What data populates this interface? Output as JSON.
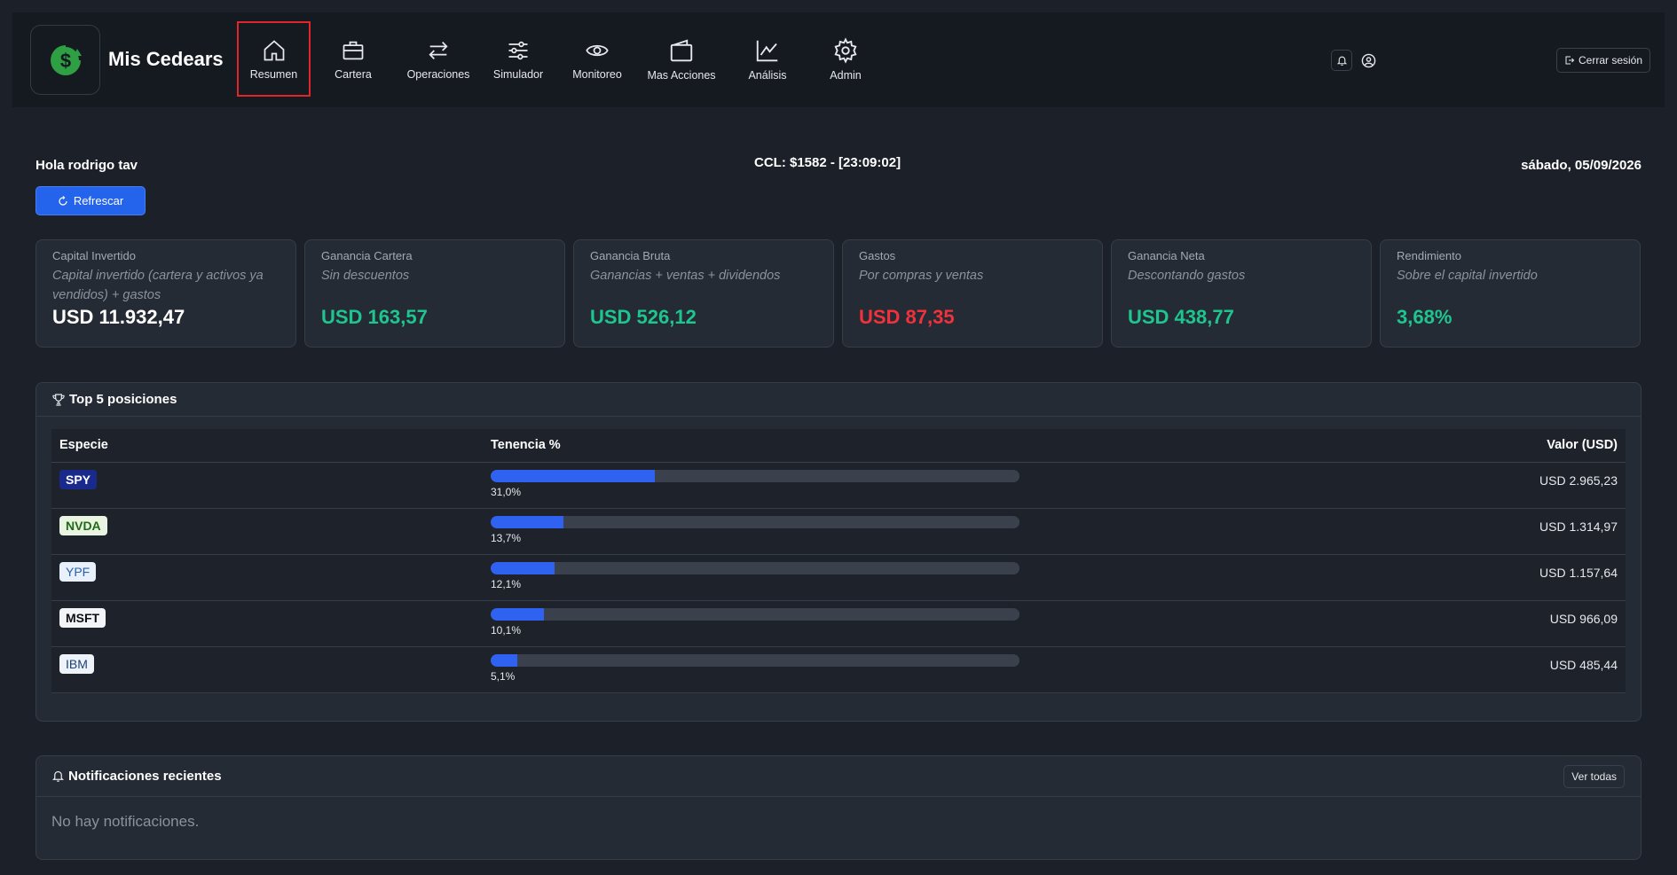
{
  "nav": {
    "brand": "Mis Cedears",
    "items": [
      {
        "label": "Resumen",
        "icon": "home-icon",
        "active": true
      },
      {
        "label": "Cartera",
        "icon": "briefcase-icon"
      },
      {
        "label": "Operaciones",
        "icon": "arrows-swap-icon"
      },
      {
        "label": "Simulador",
        "icon": "sliders-icon"
      },
      {
        "label": "Monitoreo",
        "icon": "eye-icon"
      },
      {
        "label": "Mas Acciones",
        "icon": "wallet-icon"
      },
      {
        "label": "Análisis",
        "icon": "chart-line-icon"
      },
      {
        "label": "Admin",
        "icon": "gear-icon"
      }
    ],
    "logout_label": "Cerrar sesión"
  },
  "header": {
    "greeting": "Hola rodrigo tav",
    "ccl": "CCL: $1582 - [23:09:02]",
    "date": "sábado, 05/09/2026",
    "refresh_label": "Refrescar"
  },
  "cards": [
    {
      "title": "Capital Invertido",
      "subtitle": "Capital invertido (cartera y activos ya vendidos) + gastos",
      "value": "USD 11.932,47",
      "color": "#ffffff"
    },
    {
      "title": "Ganancia Cartera",
      "subtitle": "Sin descuentos",
      "value": "USD 163,57",
      "color": "#1fc58e"
    },
    {
      "title": "Ganancia Bruta",
      "subtitle": "Ganancias + ventas + dividendos",
      "value": "USD 526,12",
      "color": "#1fc58e"
    },
    {
      "title": "Gastos",
      "subtitle": "Por compras y ventas",
      "value": "USD 87,35",
      "color": "#f0323c"
    },
    {
      "title": "Ganancia Neta",
      "subtitle": "Descontando gastos",
      "value": "USD 438,77",
      "color": "#1fc58e"
    },
    {
      "title": "Rendimiento",
      "subtitle": "Sobre el capital invertido",
      "value": "3,68%",
      "color": "#1fc58e"
    }
  ],
  "top5": {
    "title": "Top 5 posiciones",
    "headers": [
      "Especie",
      "Tenencia %",
      "Valor (USD)"
    ],
    "rows": [
      {
        "ticker": "SPY",
        "pct_label": "31,0%",
        "pct": 31.0,
        "value": "USD 2.965,23",
        "tag_bg": "#1a2a8c",
        "tag_fg": "#ffffff",
        "bold": true
      },
      {
        "ticker": "NVDA",
        "pct_label": "13,7%",
        "pct": 13.7,
        "value": "USD 1.314,97",
        "tag_bg": "#e9f5e2",
        "tag_fg": "#1f6b14",
        "bold": true
      },
      {
        "ticker": "YPF",
        "pct_label": "12,1%",
        "pct": 12.1,
        "value": "USD 1.157,64",
        "tag_bg": "#e8f1fb",
        "tag_fg": "#2b5fa8",
        "bold": false
      },
      {
        "ticker": "MSFT",
        "pct_label": "10,1%",
        "pct": 10.1,
        "value": "USD 966,09",
        "tag_bg": "#f2f4f7",
        "tag_fg": "#0c0f14",
        "bold": true
      },
      {
        "ticker": "IBM",
        "pct_label": "5,1%",
        "pct": 5.1,
        "value": "USD 485,44",
        "tag_bg": "#eef3fa",
        "tag_fg": "#1e3f7a",
        "bold": false
      }
    ]
  },
  "notifications": {
    "title": "Notificaciones recientes",
    "see_all": "Ver todas",
    "empty": "No hay notificaciones."
  }
}
